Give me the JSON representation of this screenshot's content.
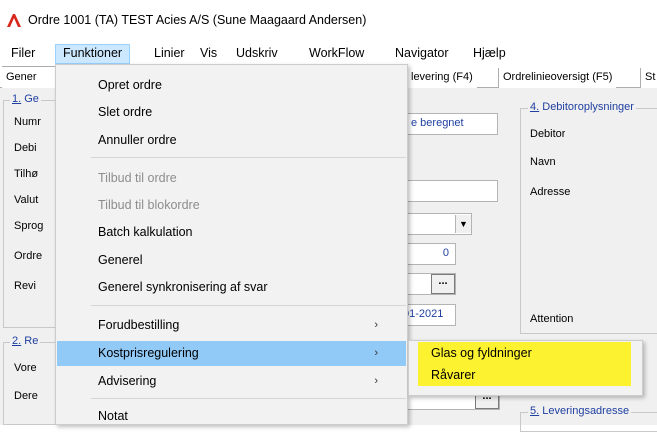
{
  "window": {
    "title": "Ordre  1001  (TA)  TEST Acies A/S  (Sune Maagaard Andersen)",
    "icon": "app-logo-icon",
    "accent_color": "#d9261c"
  },
  "menubar": {
    "items": [
      "Filer",
      "Funktioner",
      "Linier",
      "Vis",
      "Udskriv",
      "WorkFlow",
      "Navigator",
      "Hjælp"
    ],
    "active": "Funktioner"
  },
  "tabs": {
    "first": "Gener",
    "second": "levering (F4)",
    "third": "Ordrelinieoversigt (F5)",
    "fourth": "St"
  },
  "form": {
    "group1_number": "1.",
    "group1_title": " Ge",
    "labels": [
      "Numr",
      "Debi",
      "Tilhø",
      "Valut",
      "Sprog",
      "Ordre",
      "Revi"
    ],
    "status_text": "e beregnet",
    "spin_value": "0",
    "date_value": "01-2021",
    "dots": "...",
    "group2_number": "2.",
    "group2_title": " Re",
    "group2_labels": [
      "Vore",
      "Dere"
    ],
    "group4_number": "4.",
    "group4_title": " Debitoroplysninger",
    "group4_labels": [
      "Debitor",
      "Navn",
      "Adresse",
      "Attention"
    ],
    "group5_number": "5.",
    "group5_title": " Leveringsadresse"
  },
  "dropdown": {
    "items": [
      {
        "label": "Opret ordre",
        "enabled": true
      },
      {
        "label": "Slet ordre",
        "enabled": true
      },
      {
        "label": "Annuller ordre",
        "enabled": true
      },
      {
        "label": "Tilbud til ordre",
        "enabled": false
      },
      {
        "label": "Tilbud til blokordre",
        "enabled": false
      },
      {
        "label": "Batch kalkulation",
        "enabled": true
      },
      {
        "label": "Generel",
        "enabled": true
      },
      {
        "label": "Generel synkronisering af svar",
        "enabled": true
      },
      {
        "label": "Forudbestilling",
        "enabled": true,
        "submenu": true
      },
      {
        "label": "Kostprisregulering",
        "enabled": true,
        "submenu": true,
        "highlighted": true
      },
      {
        "label": "Advisering",
        "enabled": true,
        "submenu": true
      },
      {
        "label": "Notat",
        "enabled": true
      }
    ],
    "submenu_arrow": "›"
  },
  "submenu": {
    "items": [
      "Glas og fyldninger",
      "Råvarer"
    ],
    "highlight_color": "#fdf230"
  }
}
